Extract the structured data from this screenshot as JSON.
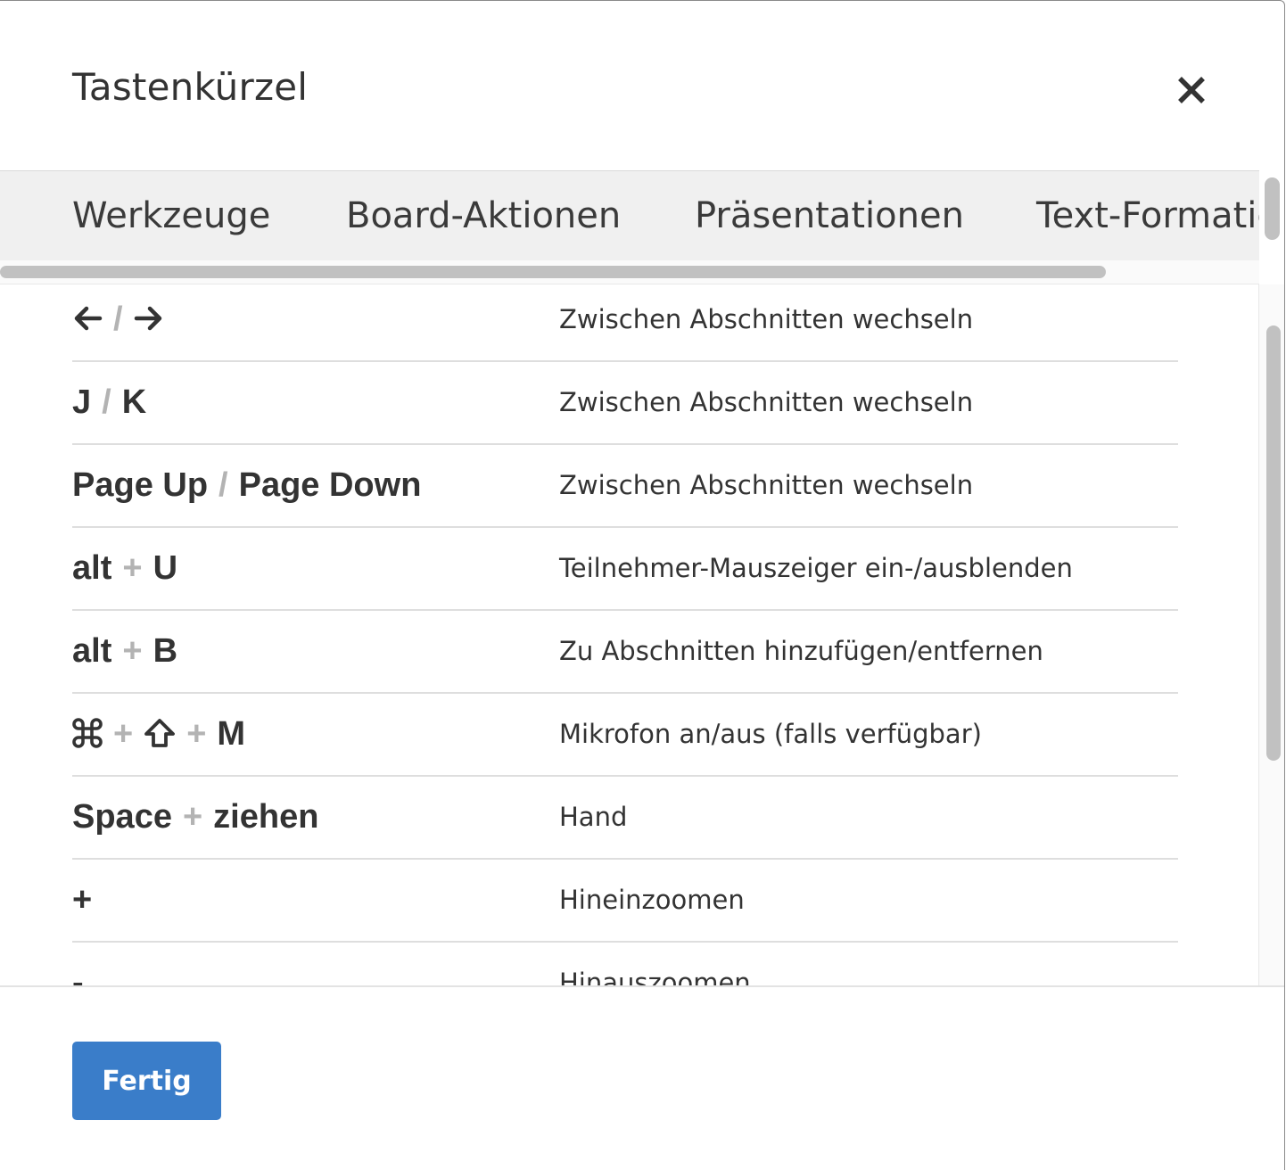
{
  "dialog": {
    "title": "Tastenkürzel",
    "close_icon": "close-icon",
    "done_label": "Fertig",
    "accent_color": "#3a7dc9"
  },
  "tabs": [
    {
      "label": "Werkzeuge"
    },
    {
      "label": "Board-Aktionen"
    },
    {
      "label": "Präsentationen"
    },
    {
      "label": "Text-Formatie"
    }
  ],
  "shortcuts": [
    {
      "keys": [
        "←",
        "→"
      ],
      "separator": "/",
      "key_icons": [
        "arrow-left-icon",
        "arrow-right-icon"
      ],
      "description": "Zwischen Abschnitten wechseln"
    },
    {
      "keys": [
        "J",
        "K"
      ],
      "separator": "/",
      "description": "Zwischen Abschnitten wechseln"
    },
    {
      "keys": [
        "Page Up",
        "Page Down"
      ],
      "separator": "/",
      "description": "Zwischen Abschnitten wechseln"
    },
    {
      "keys": [
        "alt",
        "U"
      ],
      "separator": "+",
      "description": "Teilnehmer-Mauszeiger ein-/ausblenden"
    },
    {
      "keys": [
        "alt",
        "B"
      ],
      "separator": "+",
      "description": "Zu Abschnitten hinzufügen/entfernen"
    },
    {
      "keys": [
        "⌘",
        "⇧",
        "M"
      ],
      "separator": "+",
      "key_icons": [
        "command-icon",
        "shift-icon"
      ],
      "description": "Mikrofon an/aus (falls verfügbar)"
    },
    {
      "keys": [
        "Space",
        "ziehen"
      ],
      "separator": "+",
      "description": "Hand"
    },
    {
      "keys": [
        "+"
      ],
      "description": "Hineinzoomen"
    },
    {
      "keys": [
        "-"
      ],
      "description": "Hinauszoomen"
    }
  ]
}
